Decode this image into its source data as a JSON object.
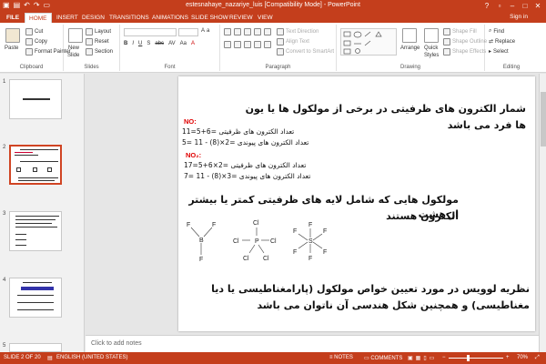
{
  "window": {
    "title": "estesnahaye_nazariye_luis [Compatibility Mode] - PowerPoint",
    "signin": "Sign in",
    "min_glyph": "–",
    "max_glyph": "□",
    "close_glyph": "✕"
  },
  "tabs": [
    {
      "label": "FILE"
    },
    {
      "label": "HOME"
    },
    {
      "label": "INSERT"
    },
    {
      "label": "DESIGN"
    },
    {
      "label": "TRANSITIONS"
    },
    {
      "label": "ANIMATIONS"
    },
    {
      "label": "SLIDE SHOW"
    },
    {
      "label": "REVIEW"
    },
    {
      "label": "VIEW"
    }
  ],
  "active_tab": "HOME",
  "ribbon": {
    "clipboard": {
      "label": "Clipboard",
      "paste": "Paste",
      "cut": "Cut",
      "copy": "Copy",
      "format_painter": "Format Painter"
    },
    "slides": {
      "label": "Slides",
      "new_slide": "New",
      "new_slide2": "Slide",
      "layout": "Layout",
      "reset": "Reset",
      "section": "Section"
    },
    "font": {
      "label": "Font"
    },
    "paragraph": {
      "label": "Paragraph",
      "text_direction": "Text Direction",
      "align_text": "Align Text",
      "convert_smartart": "Convert to SmartArt"
    },
    "drawing": {
      "label": "Drawing",
      "arrange": "Arrange",
      "quick_styles": "Quick",
      "quick_styles2": "Styles",
      "shape_fill": "Shape Fill",
      "shape_outline": "Shape Outline",
      "shape_effects": "Shape Effects"
    },
    "editing": {
      "label": "Editing",
      "find": "Find",
      "replace": "Replace",
      "select": "Select"
    }
  },
  "thumbnails": {
    "numbers": [
      "1",
      "2",
      "3",
      "4",
      "5"
    ],
    "selected_index": 2
  },
  "slide": {
    "heading1_line1": "شمار الکترون های ظرفیتی در برخی از مولکول ها یا یون",
    "heading1_line2": "ها فرد می باشد",
    "no_label": "NO:",
    "no_formula1": "تعداد الکترون های ظرفیتی =6+5=11",
    "no_formula2": "تعداد الکترون های پیوندی =2×(8) - 11 =5",
    "no2_label": "NO₂:",
    "no2_formula1": "تعداد الکترون های ظرفیتی =2×6+5=17",
    "no2_formula2": "تعداد الکترون های پیوندی =3×(8) - 11 =7",
    "heading2_line1": "مولکول هایی که شامل لایه های ظرفیتی کمتر یا بیشتر از هشت",
    "heading2_line2": "الکترون هستند",
    "molecules": {
      "bf3": {
        "center": "B",
        "ligand": "F"
      },
      "pcl5": {
        "center": "P",
        "ligand": "Cl"
      },
      "sf6": {
        "center": "S",
        "ligand": "F"
      }
    },
    "heading3_line1": "نظریه لوویس در مورد تعیین خواص مولکول (پارامغناطیسی یا دیا",
    "heading3_line2": "مغناطیسی) و همچنین شکل هندسی  آن ناتوان می باشد"
  },
  "notes": {
    "placeholder": "Click to add notes"
  },
  "status": {
    "slide_info": "SLIDE 2 OF 20",
    "language": "ENGLISH (UNITED STATES)",
    "notes": "NOTES",
    "comments": "COMMENTS",
    "zoom": "70%",
    "zoom_level": 0.7
  },
  "colors": {
    "accent": "#c43e1c",
    "highlight_red": "#e00000"
  }
}
